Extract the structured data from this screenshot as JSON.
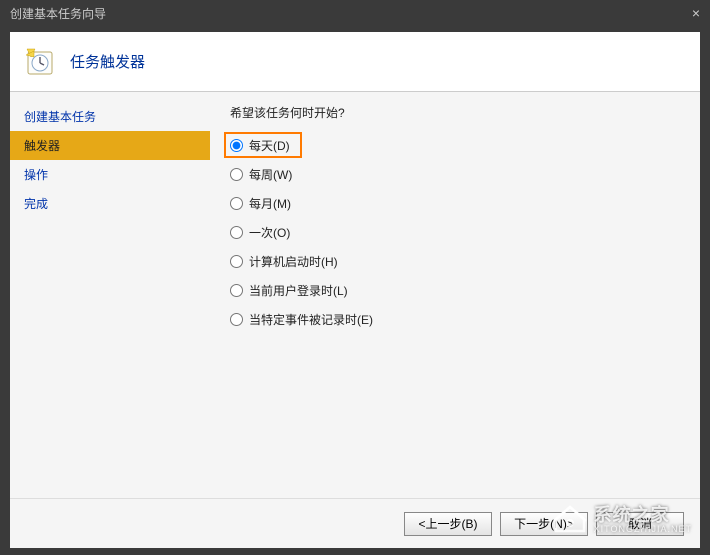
{
  "window": {
    "title": "创建基本任务向导"
  },
  "header": {
    "title": "任务触发器"
  },
  "sidebar": {
    "items": [
      {
        "label": "创建基本任务",
        "active": false
      },
      {
        "label": "触发器",
        "active": true
      },
      {
        "label": "操作",
        "active": false
      },
      {
        "label": "完成",
        "active": false
      }
    ]
  },
  "main": {
    "prompt": "希望该任务何时开始?",
    "options": [
      {
        "label": "每天(D)",
        "checked": true,
        "highlighted": true
      },
      {
        "label": "每周(W)",
        "checked": false
      },
      {
        "label": "每月(M)",
        "checked": false
      },
      {
        "label": "一次(O)",
        "checked": false
      },
      {
        "label": "计算机启动时(H)",
        "checked": false
      },
      {
        "label": "当前用户登录时(L)",
        "checked": false
      },
      {
        "label": "当特定事件被记录时(E)",
        "checked": false
      }
    ]
  },
  "footer": {
    "back": "<上一步(B)",
    "next": "下一步(N)>",
    "cancel": "取消"
  },
  "watermark": {
    "brand": "系统之家",
    "sub": "XITONGZHIJIA.NET"
  }
}
